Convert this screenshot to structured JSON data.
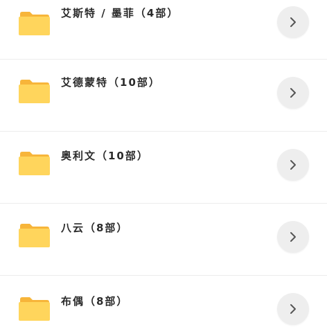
{
  "folders": [
    {
      "title": "艾斯特 / 墨菲（4部）",
      "icon": "folder-icon",
      "action_icon": "chevron-right-icon"
    },
    {
      "title": "艾德蒙特（10部）",
      "icon": "folder-icon",
      "action_icon": "chevron-right-icon"
    },
    {
      "title": "奥利文（10部）",
      "icon": "folder-icon",
      "action_icon": "chevron-right-icon"
    },
    {
      "title": "八云（8部）",
      "icon": "folder-icon",
      "action_icon": "chevron-right-icon"
    },
    {
      "title": "布偶（8部）",
      "icon": "folder-icon",
      "action_icon": "chevron-right-icon"
    }
  ],
  "colors": {
    "folder_body": "#FFD55C",
    "folder_tab": "#F7B53A",
    "chevron": "#555555",
    "button_bg": "#EEEEEE"
  }
}
